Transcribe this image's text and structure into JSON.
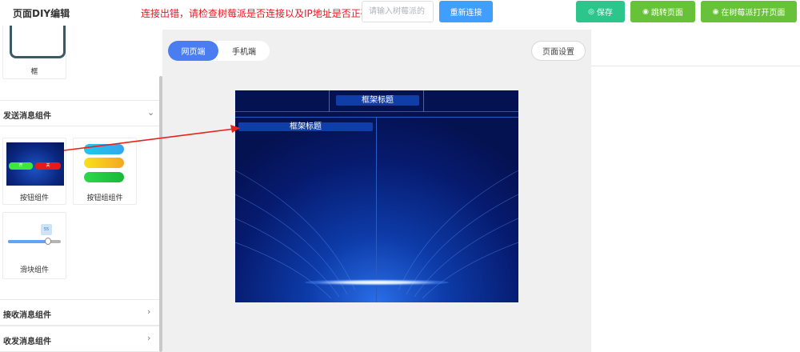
{
  "header": {
    "title": "页面DIY编辑",
    "error_message": "连接出错，请检查树莓派是否连接以及IP地址是否正确!",
    "ip_placeholder": "请输入树莓派的",
    "reconnect_label": "重新连接",
    "save_label": "保存",
    "jump_label": "跳转页面",
    "open_label": "在树莓派打开页面"
  },
  "sidebar": {
    "frame_label": "框",
    "sections": [
      {
        "title": "发送消息组件",
        "expanded": true
      },
      {
        "title": "接收消息组件",
        "expanded": false
      },
      {
        "title": "收发消息组件",
        "expanded": false
      }
    ],
    "components": {
      "button_label": "按钮组件",
      "button_on": "开",
      "button_off": "关",
      "button_group_label": "按钮组组件",
      "slider_label": "滑块组件",
      "slider_value": "55"
    }
  },
  "canvas": {
    "tabs": [
      "网页端",
      "手机端"
    ],
    "active_tab": "网页端",
    "page_settings_label": "页面设置",
    "frame_title": "框架标题",
    "frame_subtitle": "框架标题"
  },
  "colors": {
    "primary": "#409eff",
    "save": "#2cc68d",
    "success": "#67c23a",
    "error": "#f0141e",
    "tab_active": "#4a7df0"
  },
  "icons": {
    "save": "check-circle-icon",
    "jump": "eye-icon",
    "open": "eye-icon",
    "expand": "chevron-down-icon",
    "collapse": "chevron-right-icon"
  }
}
